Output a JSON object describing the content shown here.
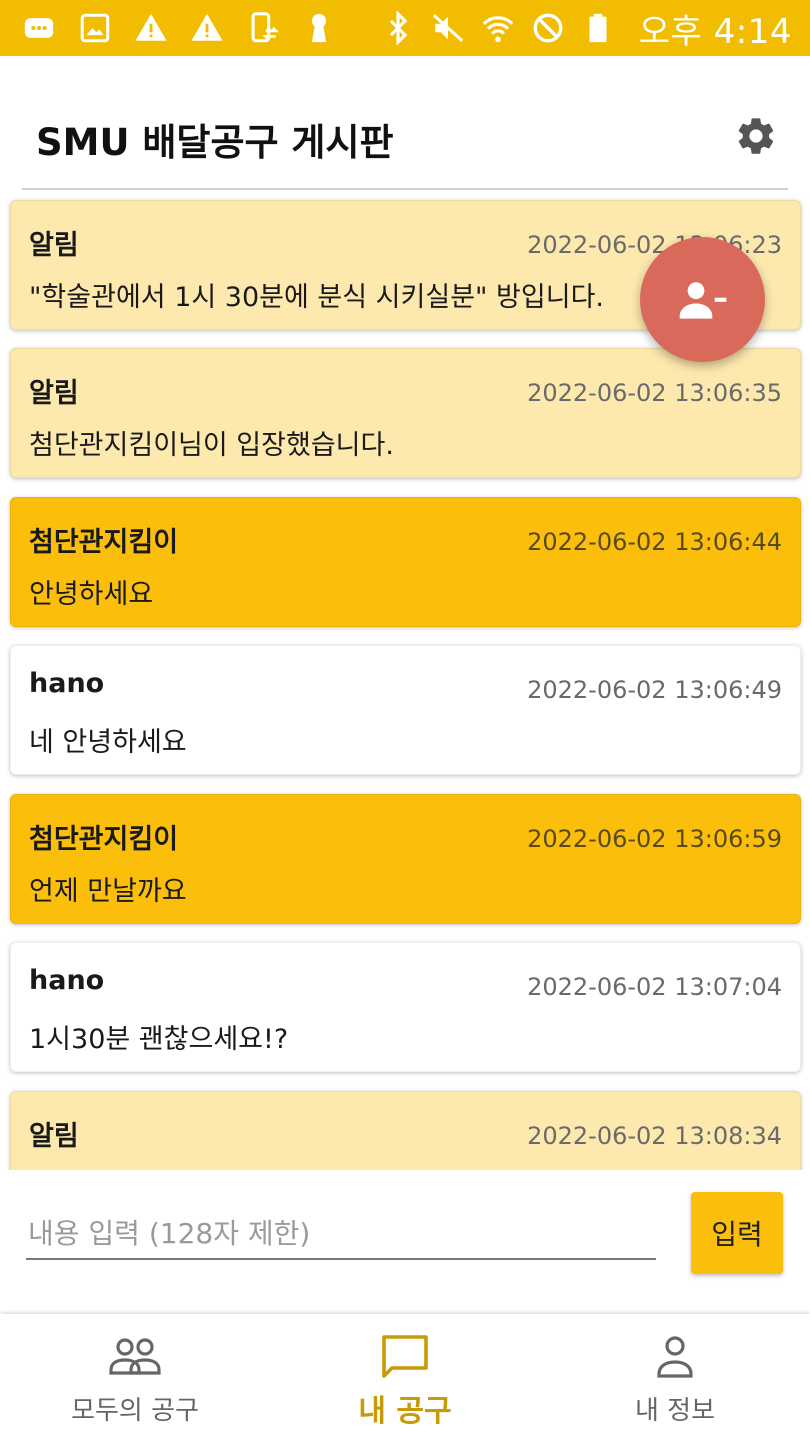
{
  "status_bar": {
    "time": "오후 4:14",
    "left_icons": [
      "chat-bubble-icon",
      "image-icon",
      "warning-icon",
      "warning-icon",
      "phone-sync-icon",
      "keyhole-icon"
    ],
    "right_icons": [
      "bluetooth-icon",
      "mute-icon",
      "wifi-icon",
      "do-not-disturb-icon",
      "battery-icon"
    ]
  },
  "header": {
    "title": "SMU 배달공구 게시판",
    "settings_icon": "gear-icon"
  },
  "fab": {
    "icon": "remove-person-icon",
    "color": "#d9695b"
  },
  "messages": [
    {
      "type": "notice",
      "sender": "알림",
      "time": "2022-06-02 13:06:23",
      "body": "\"학술관에서 1시 30분에 분식 시키실분\" 방입니다."
    },
    {
      "type": "notice",
      "sender": "알림",
      "time": "2022-06-02 13:06:35",
      "body": "첨단관지킴이님이 입장했습니다."
    },
    {
      "type": "mine",
      "sender": "첨단관지킴이",
      "time": "2022-06-02 13:06:44",
      "body": "안녕하세요"
    },
    {
      "type": "other",
      "sender": "hano",
      "time": "2022-06-02 13:06:49",
      "body": "네 안녕하세요"
    },
    {
      "type": "mine",
      "sender": "첨단관지킴이",
      "time": "2022-06-02 13:06:59",
      "body": "언제 만날까요"
    },
    {
      "type": "other",
      "sender": "hano",
      "time": "2022-06-02 13:07:04",
      "body": "1시30분 괜찮으세요!?"
    },
    {
      "type": "notice",
      "sender": "알림",
      "time": "2022-06-02 13:08:34",
      "body": ""
    }
  ],
  "input": {
    "placeholder": "내용 입력 (128자 제한)",
    "value": "",
    "send_label": "입력"
  },
  "bottom_nav": {
    "items": [
      {
        "label": "모두의 공구",
        "icon": "group-icon",
        "active": false
      },
      {
        "label": "내 공구",
        "icon": "chat-icon",
        "active": true
      },
      {
        "label": "내 정보",
        "icon": "person-icon",
        "active": false
      }
    ]
  },
  "colors": {
    "accent": "#f2bc00",
    "notice_bg": "#fde9ae",
    "mine_bg": "#fbbf0b",
    "other_bg": "#ffffff",
    "nav_active": "#c79a06"
  }
}
